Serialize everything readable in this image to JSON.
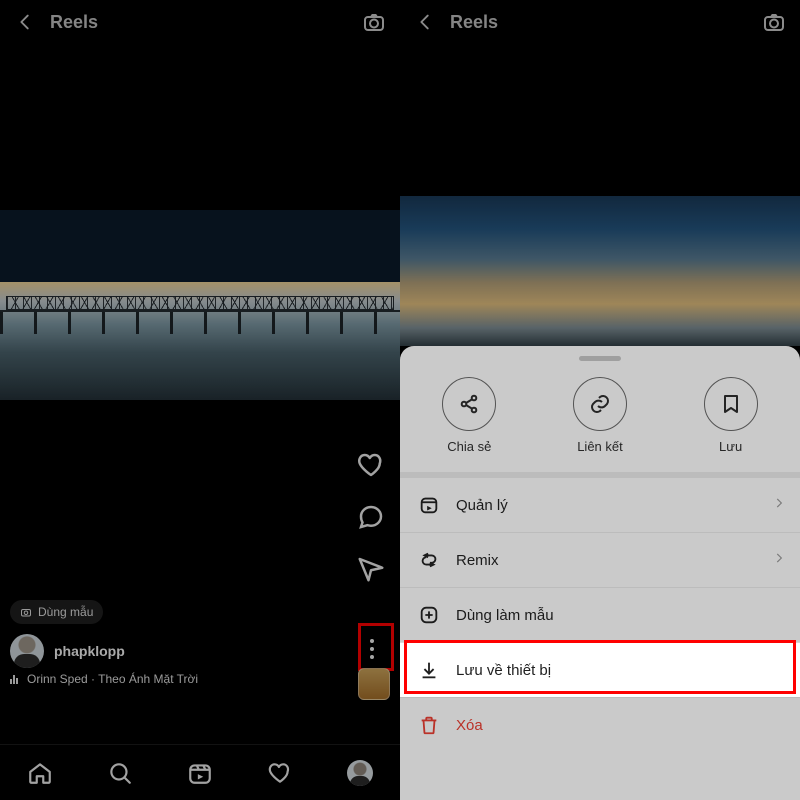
{
  "left": {
    "header": {
      "title": "Reels"
    },
    "template_pill": "Dùng mẫu",
    "username": "phapklopp",
    "audio": "Orinn Sped · Theo Ánh Mặt Trời"
  },
  "right": {
    "header": {
      "title": "Reels"
    },
    "sheet": {
      "top": [
        {
          "label": "Chia sẻ"
        },
        {
          "label": "Liên kết"
        },
        {
          "label": "Lưu"
        }
      ],
      "items": [
        {
          "label": "Quản lý",
          "chevron": true
        },
        {
          "label": "Remix",
          "chevron": true
        },
        {
          "label": "Dùng làm mẫu",
          "chevron": false
        },
        {
          "label": "Lưu về thiết bị",
          "chevron": false,
          "highlight": true
        },
        {
          "label": "Xóa",
          "chevron": false,
          "danger": true
        }
      ]
    }
  }
}
